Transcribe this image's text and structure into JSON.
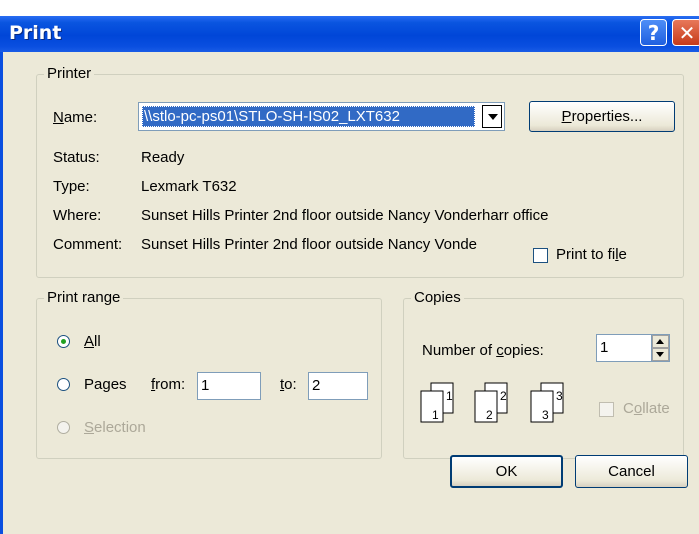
{
  "window": {
    "title": "Print",
    "help_glyph": "?",
    "close_glyph": "✕"
  },
  "printer": {
    "legend": "Printer",
    "name_label": "Name:",
    "name_value": "\\\\stlo-pc-ps01\\STLO-SH-IS02_LXT632",
    "properties_label": "Properties...",
    "status_label": "Status:",
    "status_value": "Ready",
    "type_label": "Type:",
    "type_value": "Lexmark T632",
    "where_label": "Where:",
    "where_value": "Sunset Hills Printer 2nd floor outside Nancy Vonderharr office",
    "comment_label": "Comment:",
    "comment_value": "Sunset Hills Printer 2nd floor outside Nancy Vonde",
    "print_to_file_label": "Print to file",
    "print_to_file_checked": false
  },
  "print_range": {
    "legend": "Print range",
    "options": [
      {
        "label": "All",
        "selected": true,
        "enabled": true
      },
      {
        "label": "Pages",
        "selected": false,
        "enabled": true
      },
      {
        "label": "Selection",
        "selected": false,
        "enabled": false
      }
    ],
    "from_label": "from:",
    "from_value": "1",
    "to_label": "to:",
    "to_value": "2"
  },
  "copies": {
    "legend": "Copies",
    "number_label": "Number of copies:",
    "number_value": "1",
    "collate_label": "Collate",
    "collate_checked": false,
    "collate_enabled": false,
    "page_digits": [
      "1",
      "1",
      "2",
      "2",
      "3",
      "3"
    ]
  },
  "buttons": {
    "ok": "OK",
    "cancel": "Cancel"
  }
}
